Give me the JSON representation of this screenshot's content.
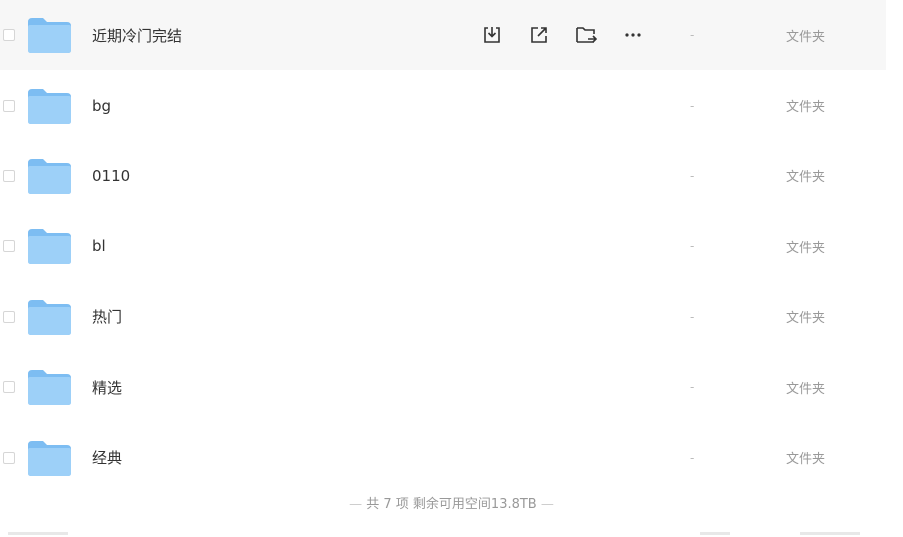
{
  "files": [
    {
      "name": "近期冷门完结",
      "size": "-",
      "type": "文件夹"
    },
    {
      "name": "bg",
      "size": "-",
      "type": "文件夹"
    },
    {
      "name": "0110",
      "size": "-",
      "type": "文件夹"
    },
    {
      "name": "bl",
      "size": "-",
      "type": "文件夹"
    },
    {
      "name": "热门",
      "size": "-",
      "type": "文件夹"
    },
    {
      "name": "精选",
      "size": "-",
      "type": "文件夹"
    },
    {
      "name": "经典",
      "size": "-",
      "type": "文件夹"
    }
  ],
  "row_actions": [
    "download-icon",
    "share-icon",
    "move-icon",
    "more-icon"
  ],
  "footer": {
    "text": "共 7 项 剩余可用空间13.8TB",
    "dash": "—"
  },
  "colors": {
    "folder": "#8cc8f5",
    "hover_row": "#f7f7f7"
  }
}
